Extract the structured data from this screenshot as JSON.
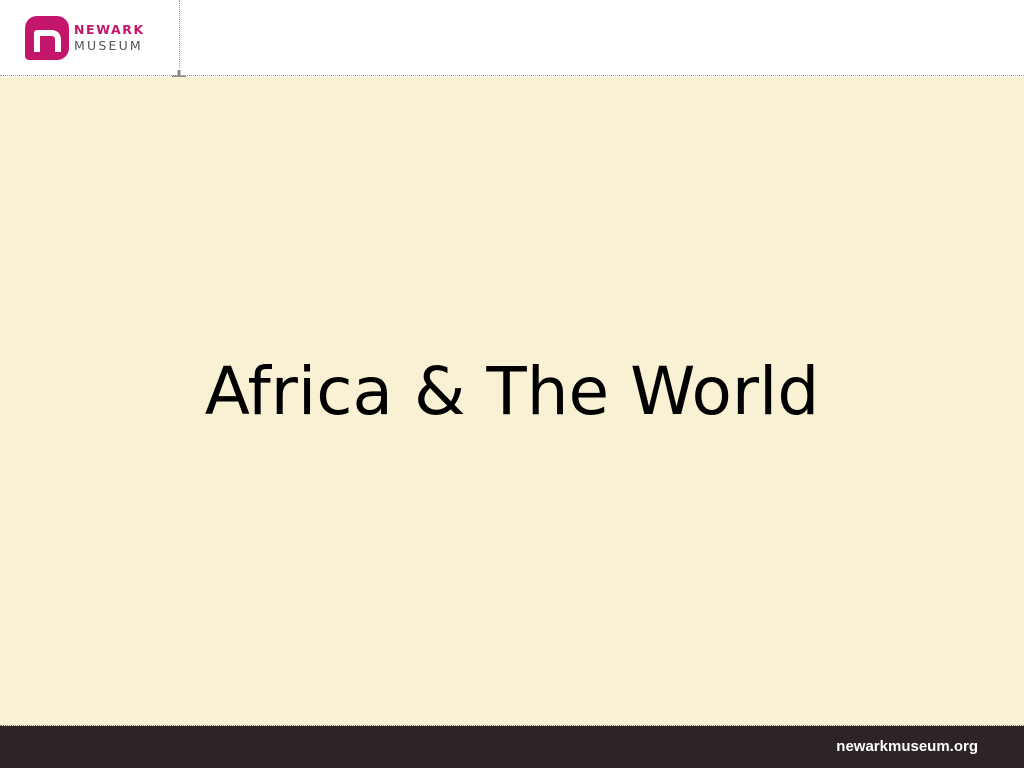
{
  "header": {
    "logo": {
      "line1": "NEWARK",
      "line2": "MUSEUM",
      "brand_color": "#c4166b",
      "icon": "newark-museum-logo-icon"
    },
    "corner_mark_icon": "plus-icon"
  },
  "slide": {
    "title": "Africa & The World",
    "background_color": "#f8f1d3"
  },
  "footer": {
    "url": "newarkmuseum.org",
    "background_color": "#2d2425"
  }
}
